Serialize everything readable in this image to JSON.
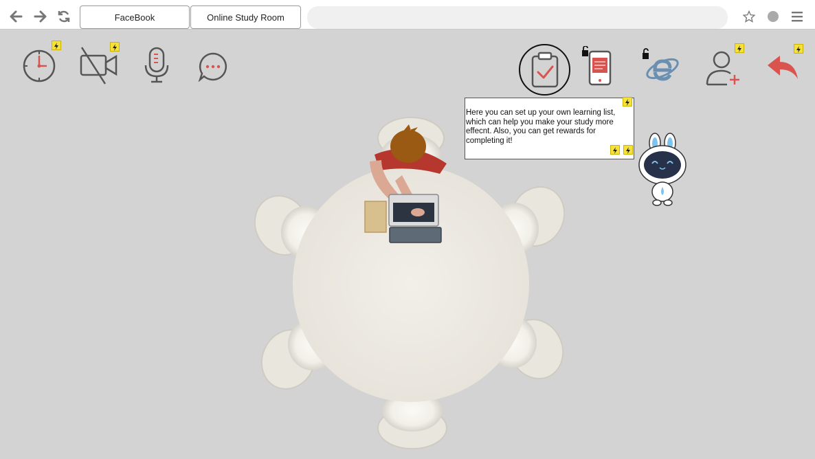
{
  "browser": {
    "tabs": [
      {
        "label": "FaceBook"
      },
      {
        "label": "Online Study Room"
      }
    ],
    "address_placeholder": ""
  },
  "tools": {
    "left": [
      {
        "name": "timer",
        "icon": "timer-icon",
        "has_badge": true
      },
      {
        "name": "camera-off",
        "icon": "video-off-icon",
        "has_badge": true
      },
      {
        "name": "microphone",
        "icon": "microphone-icon",
        "has_badge": false
      },
      {
        "name": "chat",
        "icon": "chat-icon",
        "has_badge": false
      }
    ],
    "right": [
      {
        "name": "learning-list",
        "icon": "clipboard-check-icon",
        "highlighted": true
      },
      {
        "name": "phone-lock",
        "icon": "locked-phone-icon"
      },
      {
        "name": "browser-lock",
        "icon": "locked-browser-icon"
      },
      {
        "name": "add-friend",
        "icon": "add-user-icon",
        "has_badge": true
      },
      {
        "name": "exit",
        "icon": "back-arrow-icon",
        "has_badge": true
      }
    ]
  },
  "assistant": {
    "message": "Here you can set up your own learning list, which can help you make your study more effecnt.  Also, you can get rewards for completing it!"
  },
  "colors": {
    "background": "#d3d3d3",
    "badge": "#f5e13a",
    "accent_red": "#d9534f",
    "table": "#efece6",
    "icon_gray": "#555555"
  }
}
